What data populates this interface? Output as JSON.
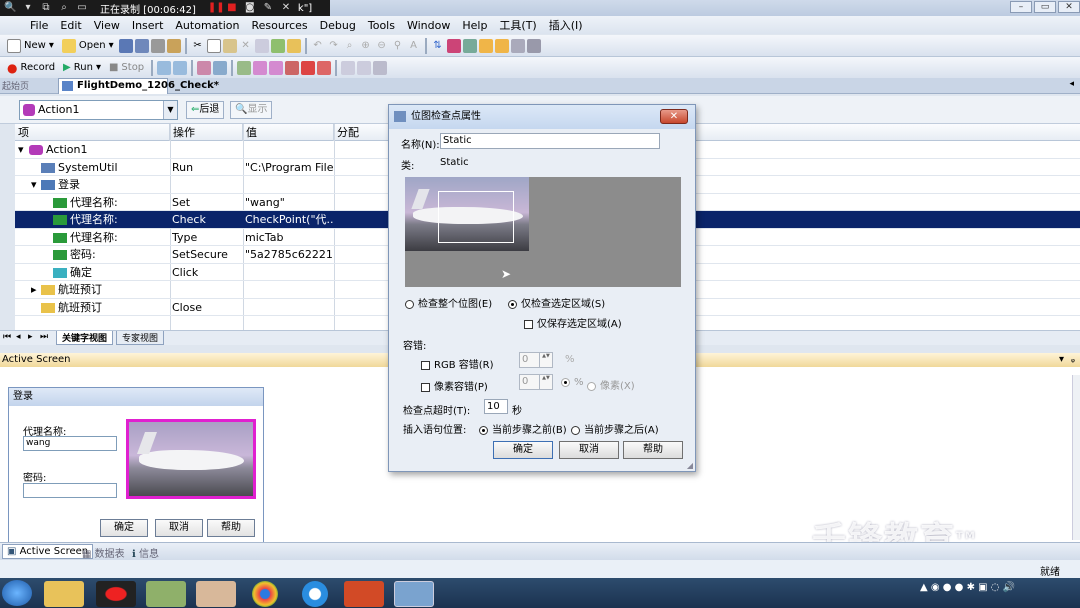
{
  "recorder": {
    "status": "正在录制 [00:06:42]"
  },
  "window": {
    "title_fragment": "k\"]"
  },
  "menu": [
    "File",
    "Edit",
    "View",
    "Insert",
    "Automation",
    "Resources",
    "Debug",
    "Tools",
    "Window",
    "Help",
    "工具(T)",
    "插入(I)"
  ],
  "toolbar1": {
    "new": "New",
    "open": "Open"
  },
  "toolbar2": {
    "record": "Record",
    "run": "Run",
    "stop": "Stop"
  },
  "tabs": {
    "left_tab": "起始页",
    "doc": "FlightDemo_1206_Check*"
  },
  "action_bar": {
    "selected": "Action1",
    "back": "后退",
    "show": "显示"
  },
  "grid": {
    "headers": [
      "项",
      "操作",
      "值",
      "分配"
    ],
    "rows": [
      {
        "item": "Action1",
        "op": "",
        "val": ""
      },
      {
        "item": "SystemUtil",
        "op": "Run",
        "val": "\"C:\\Program File..."
      },
      {
        "item": "登录",
        "op": "",
        "val": ""
      },
      {
        "item": "代理名称:",
        "op": "Set",
        "val": "\"wang\""
      },
      {
        "item": "代理名称:",
        "op": "Check",
        "val": "CheckPoint(\"代..."
      },
      {
        "item": "代理名称:",
        "op": "Type",
        "val": "micTab"
      },
      {
        "item": "密码:",
        "op": "SetSecure",
        "val": "\"5a2785c622213..."
      },
      {
        "item": "确定",
        "op": "Click",
        "val": ""
      },
      {
        "item": "航班预订",
        "op": "",
        "val": ""
      },
      {
        "item": "航班预订",
        "op": "Close",
        "val": ""
      }
    ]
  },
  "bottom_tabs": {
    "keyword": "关键字视图",
    "expert": "专家视图"
  },
  "active_screen": {
    "title": "Active Screen",
    "login": {
      "title": "登录",
      "agent_label": "代理名称:",
      "agent_value": "wang",
      "password_label": "密码:",
      "ok": "确定",
      "cancel": "取消",
      "help": "帮助"
    }
  },
  "status_tabs": {
    "active": "Active Screen",
    "data": "数据表",
    "info": "信息"
  },
  "status_right": "就绪",
  "dialog": {
    "title": "位图检查点属性",
    "close": "✕",
    "name_label": "名称(N):",
    "name_value": "Static",
    "class_label": "类:",
    "class_value": "Static",
    "radio_whole": "检查整个位图(E)",
    "radio_region": "仅检查选定区域(S)",
    "chk_save_region": "仅保存选定区域(A)",
    "tolerance": "容错:",
    "rgb": "RGB 容错(R)",
    "rgb_value": "0",
    "rgb_unit": "%",
    "pixel": "像素容错(P)",
    "pixel_value": "0",
    "pct": "%",
    "px": "像素(X)",
    "timeout_label": "检查点超时(T):",
    "timeout_value": "10",
    "timeout_unit": "秒",
    "insert_label": "插入语句位置:",
    "before": "当前步骤之前(B)",
    "after": "当前步骤之后(A)",
    "ok": "确定",
    "cancel": "取消",
    "help": "帮助"
  },
  "watermark": "千锋教育",
  "watermark_tm": "TM",
  "colors": {
    "selection": "#0a246a",
    "accent": "#c7472d",
    "magenta": "#e020d0"
  }
}
